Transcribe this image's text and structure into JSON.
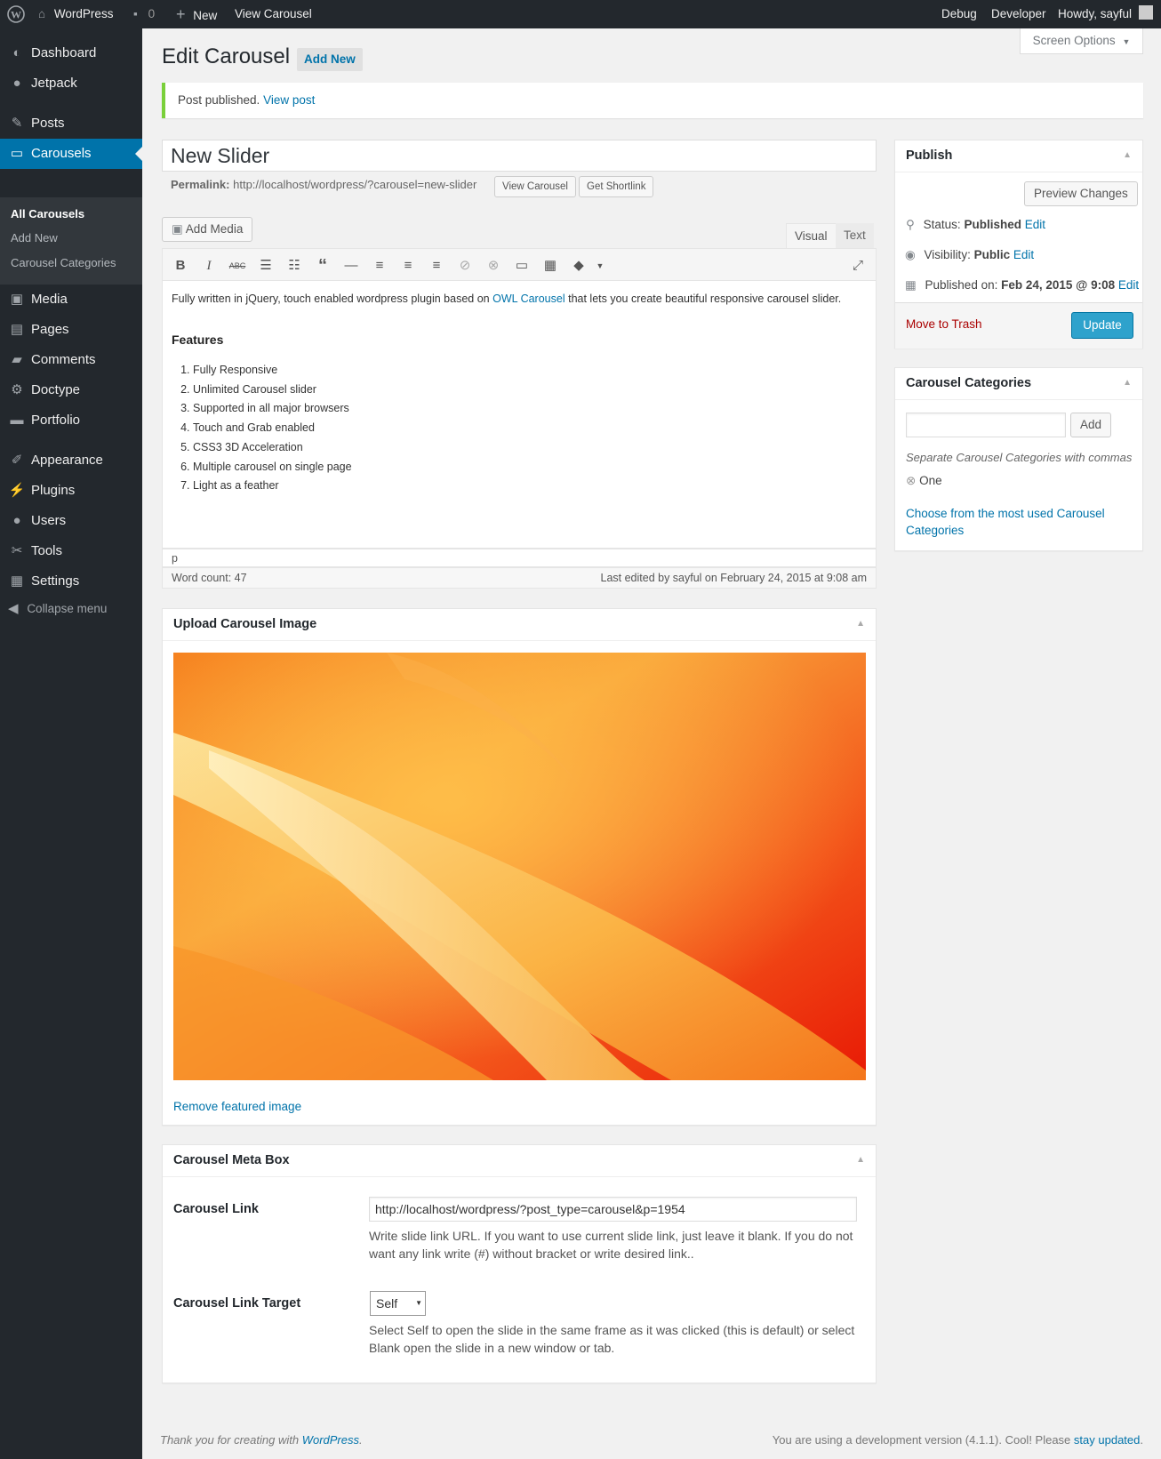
{
  "admin_bar": {
    "site_name": "WordPress",
    "comments_count": "0",
    "new_label": "New",
    "view_label": "View Carousel",
    "debug_label": "Debug",
    "developer_label": "Developer",
    "howdy_label": "Howdy, sayful"
  },
  "sidebar": {
    "items": [
      {
        "label": "Dashboard",
        "icon": "dashboard-icon"
      },
      {
        "label": "Jetpack",
        "icon": "jetpack-icon"
      },
      {
        "label": "Posts",
        "icon": "pin-icon"
      },
      {
        "label": "Carousels",
        "icon": "carousel-icon"
      },
      {
        "label": "Media",
        "icon": "media-icon"
      },
      {
        "label": "Pages",
        "icon": "pages-icon"
      },
      {
        "label": "Comments",
        "icon": "comments-icon"
      },
      {
        "label": "Doctype",
        "icon": "gear-icon"
      },
      {
        "label": "Portfolio",
        "icon": "folder-icon"
      },
      {
        "label": "Appearance",
        "icon": "brush-icon"
      },
      {
        "label": "Plugins",
        "icon": "plugin-icon"
      },
      {
        "label": "Users",
        "icon": "users-icon"
      },
      {
        "label": "Tools",
        "icon": "wrench-icon"
      },
      {
        "label": "Settings",
        "icon": "settings-icon"
      }
    ],
    "submenu": [
      "All Carousels",
      "Add New",
      "Carousel Categories"
    ],
    "collapse_label": "Collapse menu"
  },
  "page": {
    "title": "Edit Carousel",
    "add_new": "Add New",
    "screen_options": "Screen Options"
  },
  "notice": {
    "text": "Post published.",
    "link": "View post"
  },
  "post": {
    "title": "New Slider",
    "permalink_label": "Permalink:",
    "permalink_url": "http://localhost/wordpress/?carousel=new-slider",
    "view_button": "View Carousel",
    "shortlink_button": "Get Shortlink"
  },
  "editor": {
    "add_media": "Add Media",
    "tab_visual": "Visual",
    "tab_text": "Text",
    "intro_before": "Fully written in jQuery, touch enabled wordpress plugin based on",
    "intro_link": "OWL Carousel",
    "intro_after": "that lets you create beautiful responsive carousel slider.",
    "heading": "Features",
    "features": [
      "Fully Responsive",
      "Unlimited Carousel slider",
      "Supported in all major browsers",
      "Touch and Grab enabled",
      "CSS3 3D Acceleration",
      "Multiple carousel on single page",
      "Light as a feather"
    ],
    "path": "p",
    "word_count": "Word count: 47",
    "last_edited": "Last edited by sayful on February 24, 2015 at 9:08 am"
  },
  "publish": {
    "title": "Publish",
    "preview": "Preview Changes",
    "status_label": "Status:",
    "status_value": "Published",
    "visibility_label": "Visibility:",
    "visibility_value": "Public",
    "published_label": "Published on:",
    "published_value": "Feb 24, 2015 @ 9:08",
    "edit": "Edit",
    "trash": "Move to Trash",
    "update": "Update"
  },
  "categories": {
    "title": "Carousel Categories",
    "add_button": "Add",
    "hint": "Separate Carousel Categories with commas",
    "tag": "One",
    "choose_link": "Choose from the most used Carousel Categories"
  },
  "upload": {
    "title": "Upload Carousel Image",
    "remove_link": "Remove featured image"
  },
  "meta": {
    "title": "Carousel Meta Box",
    "link_label": "Carousel Link",
    "link_value": "http://localhost/wordpress/?post_type=carousel&p=1954",
    "link_desc": "Write slide link URL. If you want to use current slide link, just leave it blank. If you do not want any link write (#) without bracket or write desired link..",
    "target_label": "Carousel Link Target",
    "target_value": "Self",
    "target_desc": "Select Self to open the slide in the same frame as it was clicked (this is default) or select Blank open the slide in a new window or tab."
  },
  "footer": {
    "thanks_before": "Thank you for creating with",
    "thanks_link": "WordPress",
    "thanks_after": ".",
    "version_text": "You are using a development version (4.1.1). Cool! Please",
    "version_link": "stay updated",
    "version_after": "."
  },
  "colors": {
    "adminbar_bg": "#23282d",
    "accent": "#0073aa",
    "update_button": "#2ea2cc",
    "notice_border": "#7ad03a",
    "trash": "#a00"
  }
}
